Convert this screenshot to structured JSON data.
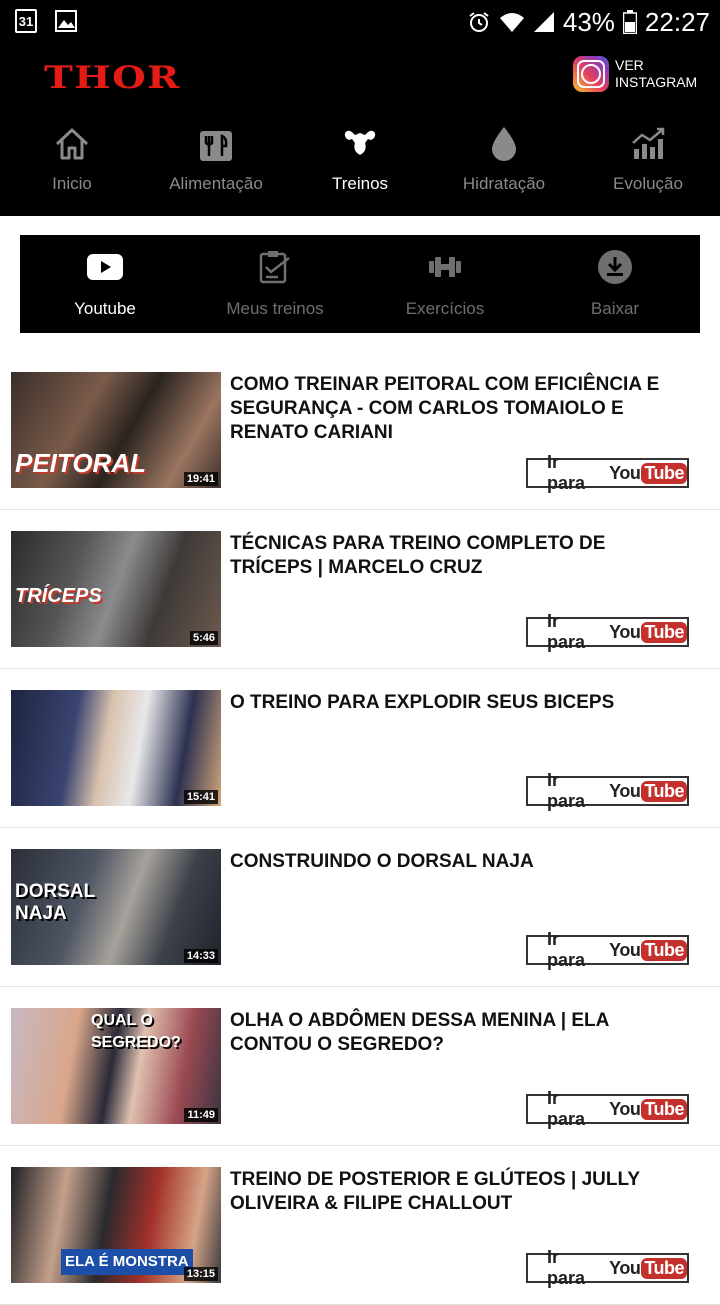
{
  "status_bar": {
    "calendar_day": "31",
    "battery": "43%",
    "time": "22:27"
  },
  "header": {
    "logo": "THOR",
    "instagram_line1": "VER",
    "instagram_line2": "INSTAGRAM"
  },
  "nav": [
    {
      "label": "Inicio",
      "icon": "home-icon"
    },
    {
      "label": "Alimentação",
      "icon": "utensils-icon"
    },
    {
      "label": "Treinos",
      "icon": "muscle-icon",
      "active": true
    },
    {
      "label": "Hidratação",
      "icon": "water-drop-icon"
    },
    {
      "label": "Evolução",
      "icon": "chart-icon"
    }
  ],
  "subtabs": [
    {
      "label": "Youtube",
      "icon": "youtube-play-icon",
      "active": true
    },
    {
      "label": "Meus treinos",
      "icon": "checklist-icon"
    },
    {
      "label": "Exercícios",
      "icon": "dumbbell-icon"
    },
    {
      "label": "Baixar",
      "icon": "download-icon"
    }
  ],
  "videos": [
    {
      "title": "COMO TREINAR PEITORAL COM EFICIÊNCIA E SEGURANÇA - COM CARLOS TOMAIOLO E RENATO CARIANI",
      "duration": "19:41",
      "thumb_text": "PEITORAL",
      "button": "Ir para"
    },
    {
      "title": "TÉCNICAS PARA TREINO COMPLETO DE TRÍCEPS | MARCELO CRUZ",
      "duration": "5:46",
      "thumb_text": "TRÍCEPS",
      "button": "Ir para"
    },
    {
      "title": "O TREINO PARA EXPLODIR SEUS BICEPS",
      "duration": "15:41",
      "thumb_text": "",
      "button": "Ir para"
    },
    {
      "title": "CONSTRUINDO O DORSAL NAJA",
      "duration": "14:33",
      "thumb_text": "DORSAL NAJA",
      "button": "Ir para"
    },
    {
      "title": "OLHA O ABDÔMEN DESSA MENINA | ELA CONTOU O SEGREDO?",
      "duration": "11:49",
      "thumb_text": "QUAL O SEGREDO?",
      "button": "Ir para"
    },
    {
      "title": "TREINO DE POSTERIOR E GLÚTEOS | JULLY OLIVEIRA & FILIPE CHALLOUT",
      "duration": "13:15",
      "thumb_text": "ELA É MONSTRA",
      "button": "Ir para"
    }
  ],
  "youtube_logo": {
    "you": "You",
    "tube": "Tube"
  },
  "colors": {
    "brand_red": "#e41b17",
    "youtube_red": "#c4302b",
    "header_bg": "#000000"
  }
}
